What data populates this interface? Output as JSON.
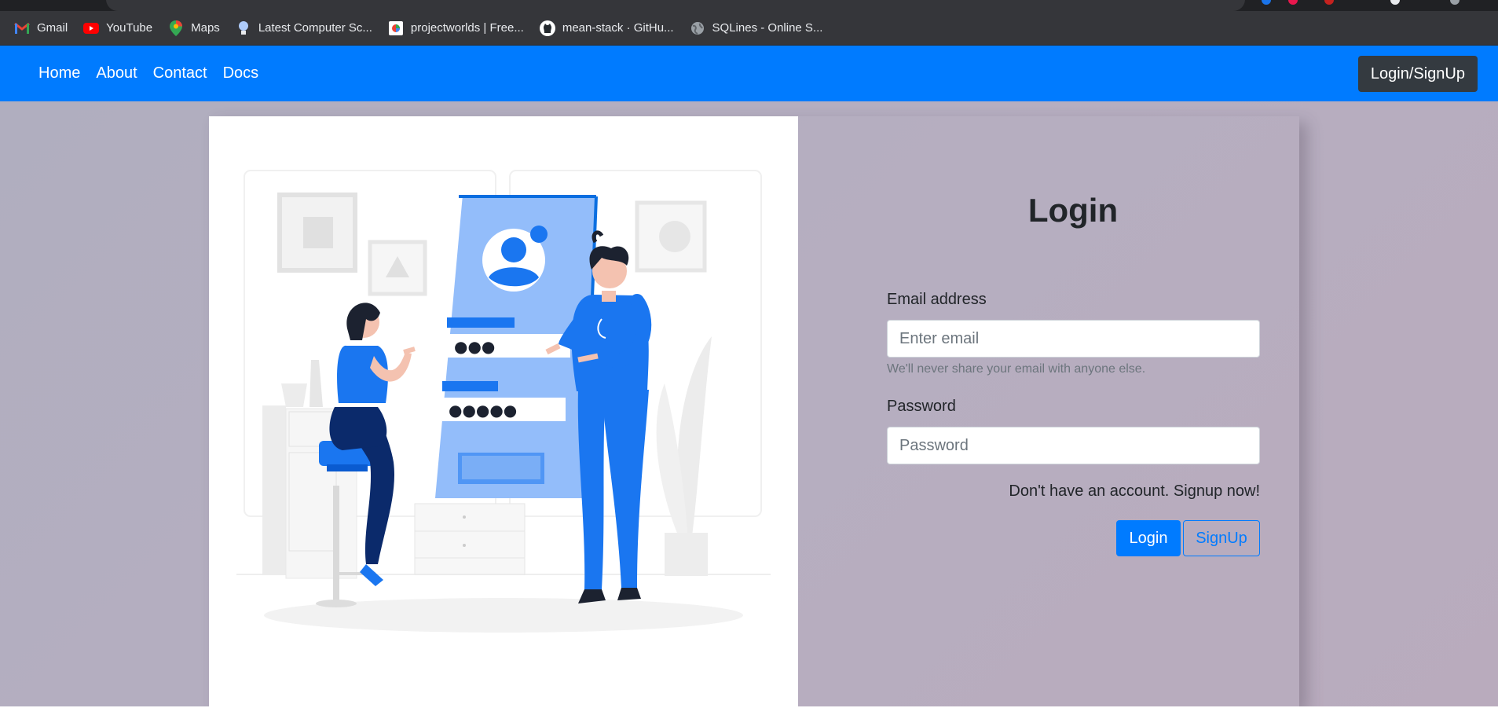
{
  "browser": {
    "bookmarks": [
      {
        "label": "Gmail",
        "icon": "gmail-icon"
      },
      {
        "label": "YouTube",
        "icon": "youtube-icon"
      },
      {
        "label": "Maps",
        "icon": "maps-icon"
      },
      {
        "label": "Latest Computer Sc...",
        "icon": "bulb-icon"
      },
      {
        "label": "projectworlds | Free...",
        "icon": "projectworlds-icon"
      },
      {
        "label": "mean-stack · GitHu...",
        "icon": "github-icon"
      },
      {
        "label": "SQLines - Online S...",
        "icon": "globe-icon"
      }
    ]
  },
  "navbar": {
    "links": [
      "Home",
      "About",
      "Contact",
      "Docs"
    ],
    "cta": "Login/SignUp",
    "color": "#007bff"
  },
  "illustration": {
    "icon": "login-illustration",
    "password_dots_short": "●●●",
    "password_dots_long": "●●●●●"
  },
  "login": {
    "title": "Login",
    "email_label": "Email address",
    "email_placeholder": "Enter email",
    "email_help": "We'll never share your email with anyone else.",
    "password_label": "Password",
    "password_placeholder": "Password",
    "signup_note": "Don't have an account. Signup now!",
    "login_button": "Login",
    "signup_button": "SignUp"
  }
}
